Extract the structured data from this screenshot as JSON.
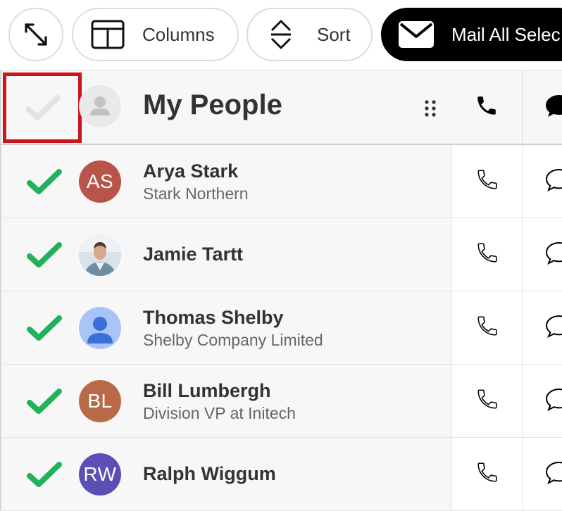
{
  "toolbar": {
    "expand_icon": "expand-arrows-icon",
    "columns_label": "Columns",
    "columns_icon": "columns-layout-icon",
    "sort_label": "Sort",
    "sort_icon": "sort-arrows-icon",
    "mail_label": "Mail All Selec",
    "mail_icon": "envelope-icon"
  },
  "header": {
    "title": "My People",
    "select_all_checked": false,
    "drag_icon": "drag-handle-icon",
    "phone_icon": "phone-icon",
    "chat_icon": "chat-bubble-icon"
  },
  "colors": {
    "check_green": "#20b15a",
    "highlight_red": "#c8161e",
    "mail_button_bg": "#000000"
  },
  "people": [
    {
      "name": "Arya Stark",
      "subtitle": "Stark Northern",
      "initials": "AS",
      "avatar_color": "#b85449",
      "avatar_type": "initials",
      "selected": true
    },
    {
      "name": "Jamie Tartt",
      "subtitle": "",
      "initials": "",
      "avatar_color": "#8fa7bb",
      "avatar_type": "photo",
      "selected": true
    },
    {
      "name": "Thomas Shelby",
      "subtitle": "Shelby Company Limited",
      "initials": "",
      "avatar_color": "#a8c3f5",
      "avatar_type": "default",
      "selected": true
    },
    {
      "name": "Bill Lumbergh",
      "subtitle": "Division VP at Initech",
      "initials": "BL",
      "avatar_color": "#b86a47",
      "avatar_type": "initials",
      "selected": true
    },
    {
      "name": "Ralph Wiggum",
      "subtitle": "",
      "initials": "RW",
      "avatar_color": "#5b4eb5",
      "avatar_type": "initials",
      "selected": true
    }
  ]
}
